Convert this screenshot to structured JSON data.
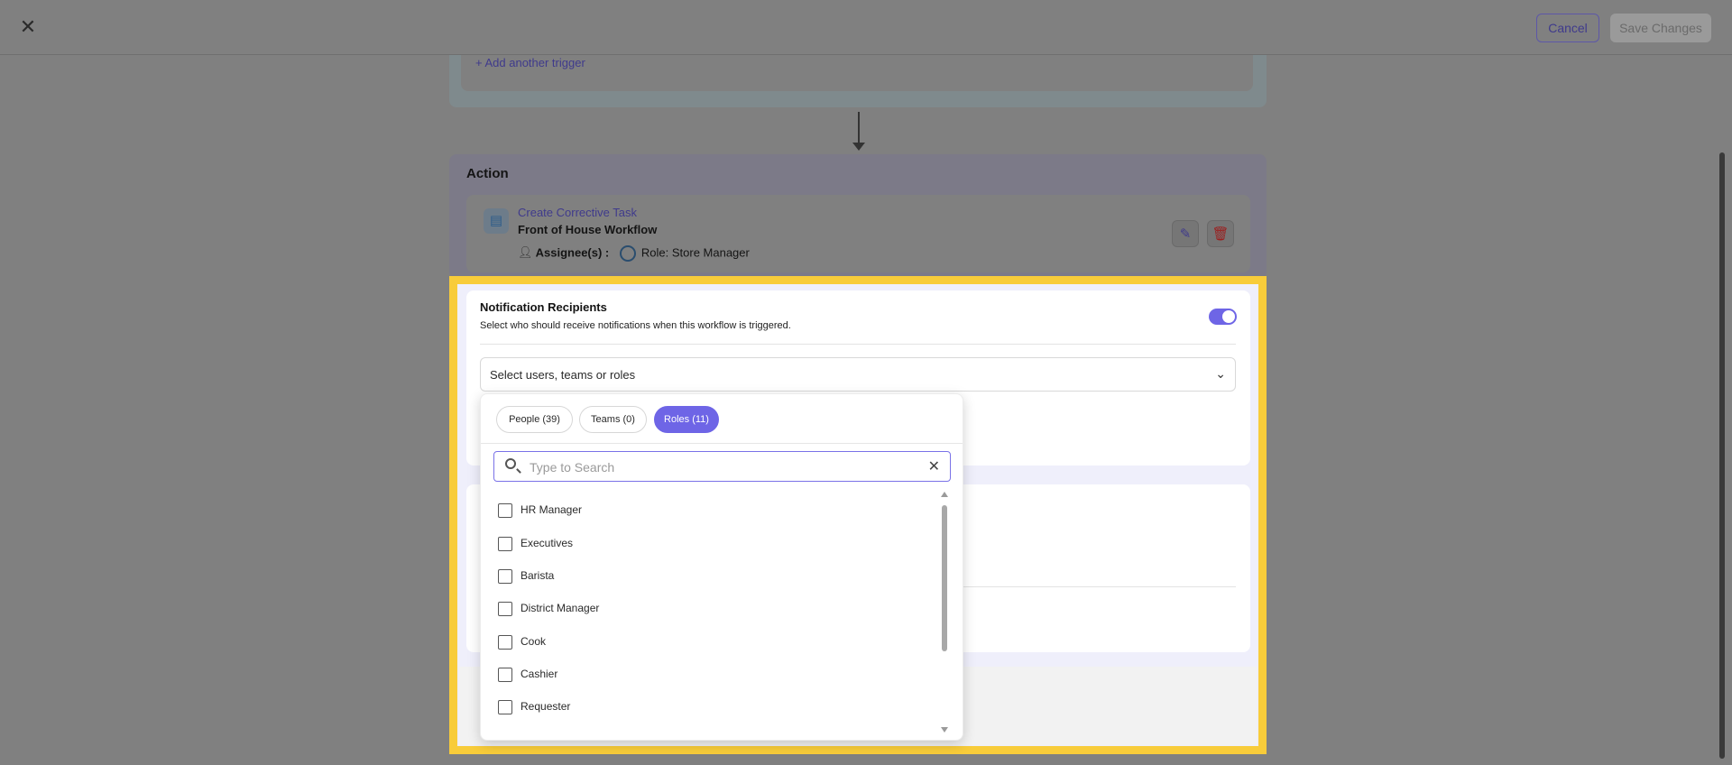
{
  "header": {
    "cancel_label": "Cancel",
    "save_label": "Save Changes"
  },
  "trigger": {
    "add_label": "+ Add another trigger"
  },
  "action": {
    "title": "Action",
    "task_link": "Create Corrective Task",
    "task_workflow": "Front of House Workflow",
    "assignee_label": "Assignee(s) :",
    "role_label": "Role: Store Manager"
  },
  "notification": {
    "title": "Notification Recipients",
    "description": "Select who should receive notifications when this workflow is triggered.",
    "toggle_on": true,
    "select_placeholder": "Select users, teams or roles"
  },
  "dropdown": {
    "tabs": [
      {
        "label": "People (39)",
        "active": false
      },
      {
        "label": "Teams (0)",
        "active": false
      },
      {
        "label": "Roles (11)",
        "active": true
      }
    ],
    "search_placeholder": "Type to Search",
    "options": [
      "HR Manager",
      "Executives",
      "Barista",
      "District Manager",
      "Cook",
      "Cashier",
      "Requester"
    ]
  },
  "colors": {
    "accent": "#6e65e6",
    "highlight": "#f8cc3a",
    "link": "#3f3a8c",
    "danger": "#9b2020"
  }
}
